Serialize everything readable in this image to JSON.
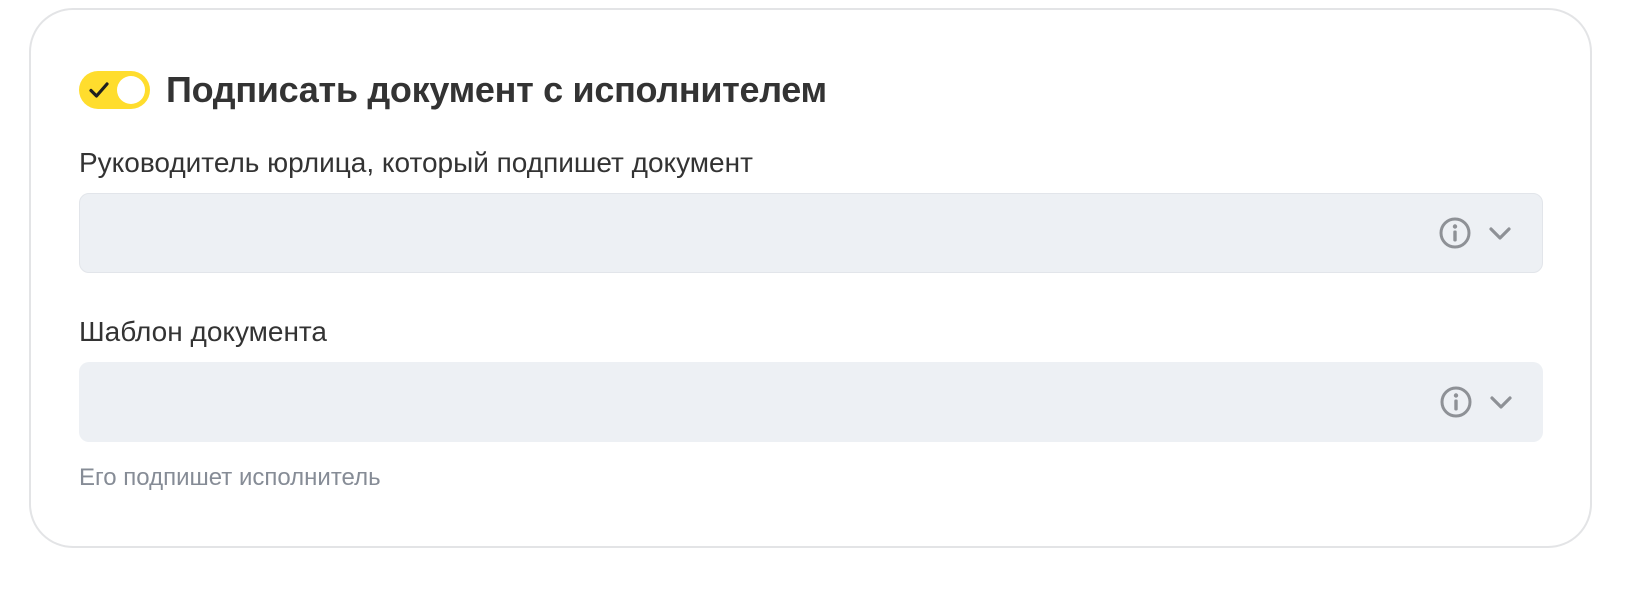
{
  "colors": {
    "toggle_on": "#ffdd2d",
    "field_background": "#edf0f4",
    "field_border": "#e2e5ea",
    "icon_gray": "#8e9196",
    "hint_text": "#868c96"
  },
  "toggle": {
    "state": "on",
    "check_icon": "check-icon"
  },
  "section": {
    "title": "Подписать документ с исполнителем"
  },
  "fields": [
    {
      "label": "Руководитель юрлица, который подпишет документ",
      "value": "",
      "icons": [
        "info-icon",
        "chevron-down-icon"
      ]
    },
    {
      "label": "Шаблон документа",
      "value": "",
      "icons": [
        "info-icon",
        "chevron-down-icon"
      ],
      "hint": "Его подпишет исполнитель"
    }
  ]
}
